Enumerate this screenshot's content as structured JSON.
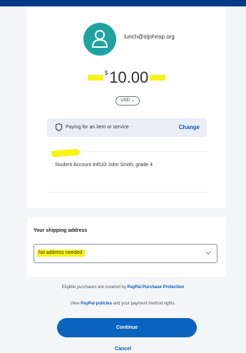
{
  "header": {
    "bar_color": "#003a87"
  },
  "payee": {
    "email": "lunch@stjohnsp.org",
    "avatar_color": "#1fa3a2",
    "avatar_icon": "user-icon"
  },
  "payment": {
    "currency_symbol": "$",
    "amount": "10.00",
    "currency_code": "USD",
    "paying_for": "Paying for an item or service",
    "change_label": "Change",
    "note": "Student Account #4533 John Smith, grade 4"
  },
  "shipping": {
    "label": "Your shipping address",
    "selected": "No address needed"
  },
  "footer": {
    "protection_prefix": "Eligible purchases are covered by ",
    "protection_link": "PayPal Purchase Protection",
    "policies_prefix": "View ",
    "policies_link": "PayPal policies",
    "policies_suffix": " and your payment method rights.",
    "continue_label": "Continue",
    "cancel_label": "Cancel"
  },
  "colors": {
    "accent": "#0a63bf",
    "highlight": "#f7f317"
  }
}
